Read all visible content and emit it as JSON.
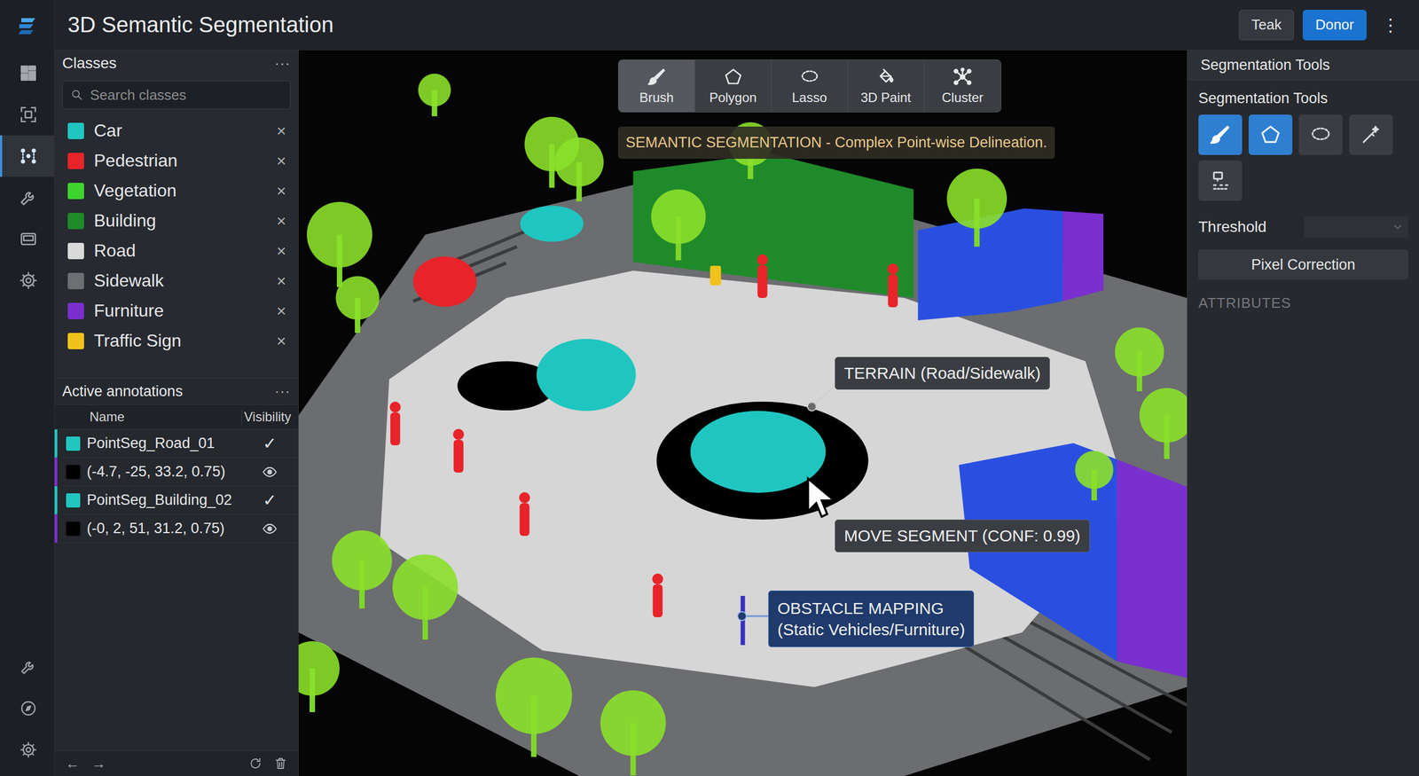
{
  "app": {
    "title": "3D Semantic Segmentation"
  },
  "header_buttons": [
    {
      "label": "Teak",
      "selected": false
    },
    {
      "label": "Donor",
      "selected": true
    }
  ],
  "header_menu": "⋮",
  "rail": {
    "top": [
      {
        "selected": false
      },
      {
        "selected": false
      },
      {
        "selected": true
      },
      {
        "selected": false
      },
      {
        "selected": false
      },
      {
        "selected": false
      }
    ],
    "bottom": [
      {
        "selected": false
      },
      {
        "selected": false
      },
      {
        "selected": false
      }
    ]
  },
  "classes": {
    "title": "Classes",
    "menu": "···",
    "search_placeholder": "Search classes",
    "remove_glyph": "×",
    "items": [
      {
        "name": "Car",
        "color": "#1fc6c0"
      },
      {
        "name": "Pedestrian",
        "color": "#e8232a"
      },
      {
        "name": "Vegetation",
        "color": "#3ed42e"
      },
      {
        "name": "Building",
        "color": "#1f8a2a"
      },
      {
        "name": "Road",
        "color": "#d9d9d9"
      },
      {
        "name": "Sidewalk",
        "color": "#6d6f72"
      },
      {
        "name": "Furniture",
        "color": "#7a2fcf"
      },
      {
        "name": "Traffic Sign",
        "color": "#f1c21b"
      }
    ]
  },
  "annotations": {
    "title": "Active annotations",
    "menu": "···",
    "columns": [
      "Name",
      "Visibility"
    ],
    "check_glyph": "✓",
    "rows": [
      {
        "kind": "layer",
        "name": "PointSeg_Road_01",
        "color": "#1fc6c0",
        "accent": "#1fc6c0",
        "checked": true
      },
      {
        "kind": "coords",
        "name": "(-4.7, -25, 33.2, 0.75)",
        "color": "#000000",
        "accent": "#7a2fcf",
        "visible": true
      },
      {
        "kind": "layer",
        "name": "PointSeg_Building_02",
        "color": "#1fc6c0",
        "accent": "#1fc6c0",
        "checked": true
      },
      {
        "kind": "coords",
        "name": "(-0, 2, 51, 31.2, 0.75)",
        "color": "#000000",
        "accent": "#7a2fcf",
        "visible": true
      }
    ]
  },
  "footer": {
    "back": "←",
    "forward": "→"
  },
  "toolbar": [
    {
      "label": "Brush",
      "selected": true
    },
    {
      "label": "Polygon",
      "selected": false
    },
    {
      "label": "Lasso",
      "selected": false
    },
    {
      "label": "3D Paint",
      "selected": false
    },
    {
      "label": "Cluster",
      "selected": false
    }
  ],
  "viewport": {
    "banner": "SEMANTIC SEGMENTATION - Complex Point-wise Delineation.",
    "terrain_callout": "TERRAIN (Road/Sidewalk)",
    "move_callout": "MOVE SEGMENT (CONF: 0.99)",
    "obstacle_callout": [
      "OBSTACLE MAPPING",
      "(Static Vehicles/Furniture)"
    ]
  },
  "tools_panel": {
    "title": "Segmentation Tools",
    "subtitle": "Segmentation Tools",
    "tools": [
      {
        "selected": true
      },
      {
        "selected": true
      },
      {
        "selected": false
      },
      {
        "selected": false
      },
      {
        "selected": false
      }
    ],
    "threshold_label": "Threshold",
    "button": "Pixel Correction",
    "attributes": "ATTRIBUTES"
  }
}
